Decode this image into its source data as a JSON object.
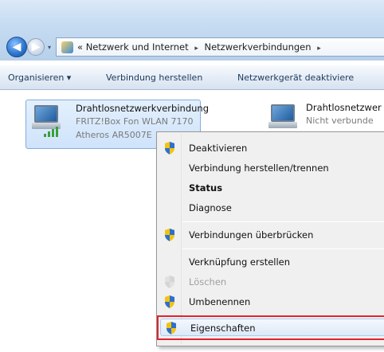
{
  "window": {
    "navigation": {
      "back_glyph": "◀",
      "forward_glyph": "▶",
      "history_glyph": "▾"
    },
    "address_bar": {
      "overflow": "«",
      "crumbs": [
        "Netzwerk und Internet",
        "Netzwerkverbindungen"
      ],
      "separator": "▸"
    }
  },
  "toolbar": {
    "items": [
      {
        "label": "Organisieren ▾"
      },
      {
        "label": "Verbindung herstellen"
      },
      {
        "label": "Netzwerkgerät deaktiviere"
      }
    ]
  },
  "connections": [
    {
      "title": "Drahtlosnetzwerkverbindung",
      "line1": "FRITZ!Box Fon WLAN 7170",
      "line2": "Atheros AR5007E",
      "selected": true
    },
    {
      "title": "Drahtlosnetzwer",
      "line1": "Nicht verbunde",
      "line2": "",
      "selected": false
    }
  ],
  "context_menu": {
    "items": [
      {
        "label": "Deaktivieren",
        "shield": true,
        "bold": false,
        "disabled": false
      },
      {
        "label": "Verbindung herstellen/trennen",
        "shield": false,
        "bold": false,
        "disabled": false
      },
      {
        "label": "Status",
        "shield": false,
        "bold": true,
        "disabled": false
      },
      {
        "label": "Diagnose",
        "shield": false,
        "bold": false,
        "disabled": false
      },
      {
        "label": "Verbindungen überbrücken",
        "shield": true,
        "bold": false,
        "disabled": false
      },
      {
        "label": "Verknüpfung erstellen",
        "shield": false,
        "bold": false,
        "disabled": false
      },
      {
        "label": "Löschen",
        "shield": true,
        "bold": false,
        "disabled": true
      },
      {
        "label": "Umbenennen",
        "shield": true,
        "bold": false,
        "disabled": false
      },
      {
        "label": "Eigenschaften",
        "shield": true,
        "bold": false,
        "disabled": false,
        "highlighted": true
      }
    ]
  },
  "colors": {
    "highlight_border": "#e3222c",
    "accent": "#2f78d2",
    "signal": "#3aa03a"
  },
  "icons": [
    "back-arrow-icon",
    "forward-arrow-icon",
    "network-folder-icon",
    "wireless-adapter-icon",
    "uac-shield-icon"
  ]
}
